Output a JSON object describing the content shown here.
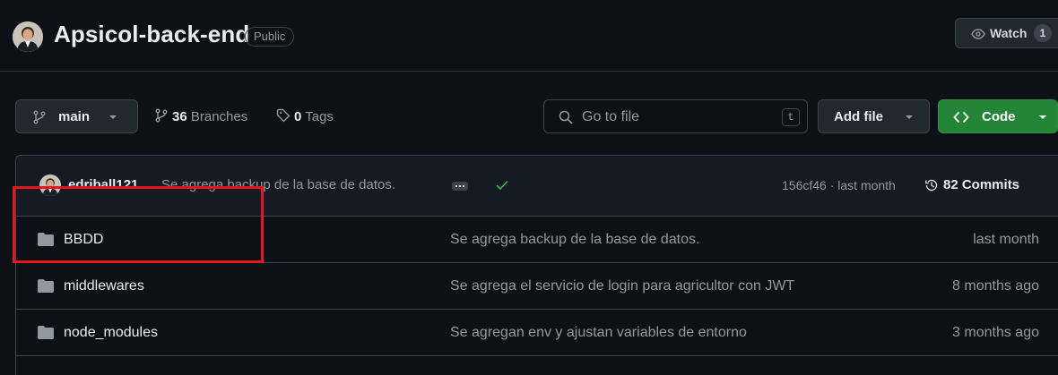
{
  "repo": {
    "name": "Apsicol-back-end",
    "visibility": "Public",
    "watch_label": "Watch",
    "watch_count": "1"
  },
  "toolbar": {
    "branch": "main",
    "branches_count": "36",
    "branches_label": "Branches",
    "tags_count": "0",
    "tags_label": "Tags",
    "search_placeholder": "Go to file",
    "search_shortcut": "t",
    "add_file_label": "Add file",
    "code_label": "Code"
  },
  "latest_commit": {
    "author": "edriball121",
    "message": "Se agrega backup de la base de datos.",
    "hash_and_time": "156cf46 · last month",
    "commits_label": "82 Commits"
  },
  "files": [
    {
      "name": "BBDD",
      "message": "Se agrega backup de la base de datos.",
      "time": "last month"
    },
    {
      "name": "middlewares",
      "message": "Se agrega el servicio de login para agricultor con JWT",
      "time": "8 months ago"
    },
    {
      "name": "node_modules",
      "message": "Se agregan env y ajustan variables de entorno",
      "time": "3 months ago"
    }
  ],
  "colors": {
    "background": "#0d1117",
    "border": "#3d444d",
    "code_button": "#238636",
    "check": "#3fb950",
    "highlight": "#e6181e"
  },
  "icons": [
    "eye-icon",
    "git-branch-icon",
    "tag-icon",
    "search-icon",
    "code-icon",
    "kebab-icon",
    "check-icon",
    "history-icon",
    "folder-icon"
  ]
}
